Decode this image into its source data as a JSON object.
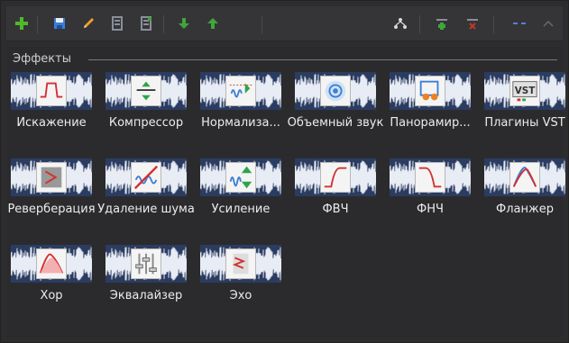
{
  "toolbar": {
    "buttons": [
      {
        "name": "add-icon",
        "color": "#4fb82c"
      },
      {
        "name": "save-icon",
        "color": "#3b7fd6"
      },
      {
        "name": "edit-icon",
        "color": "#f0a020"
      },
      {
        "name": "preset-load-icon",
        "color": "#8a8f9a"
      },
      {
        "name": "preset-save-icon",
        "color": "#8a8f9a"
      },
      {
        "name": "move-down-icon",
        "color": "#3fa63a"
      },
      {
        "name": "move-up-icon",
        "color": "#3fa63a"
      },
      {
        "name": "merge-icon",
        "color": "#d9d9d9"
      },
      {
        "name": "insert-icon",
        "color": "#3fa63a"
      },
      {
        "name": "remove-icon",
        "color": "#c0392b"
      },
      {
        "name": "collapse-icon",
        "color": "#5a7fd0"
      },
      {
        "name": "chevron-up-icon",
        "color": "#6a6a6a"
      }
    ]
  },
  "group": {
    "title": "Эффекты"
  },
  "effects": [
    {
      "label": "Искажение",
      "icon": "distortion-icon"
    },
    {
      "label": "Компрессор",
      "icon": "compressor-icon"
    },
    {
      "label": "Нормализа...",
      "icon": "normalize-icon"
    },
    {
      "label": "Объемный звук",
      "icon": "surround-icon"
    },
    {
      "label": "Панорамир...",
      "icon": "panorama-icon"
    },
    {
      "label": "Плагины VST",
      "icon": "vst-plugins-icon"
    },
    {
      "label": "Реверберация",
      "icon": "reverb-icon"
    },
    {
      "label": "Удаление шума",
      "icon": "noise-removal-icon"
    },
    {
      "label": "Усиление",
      "icon": "amplify-icon"
    },
    {
      "label": "ФВЧ",
      "icon": "highpass-icon"
    },
    {
      "label": "ФНЧ",
      "icon": "lowpass-icon"
    },
    {
      "label": "Фланжер",
      "icon": "flanger-icon"
    },
    {
      "label": "Хор",
      "icon": "chorus-icon"
    },
    {
      "label": "Эквалайзер",
      "icon": "equalizer-icon"
    },
    {
      "label": "Эхо",
      "icon": "echo-icon"
    }
  ],
  "colors": {
    "background": "#2b2b2e",
    "thumb": "#2b3c61",
    "accent_red": "#d33030"
  }
}
